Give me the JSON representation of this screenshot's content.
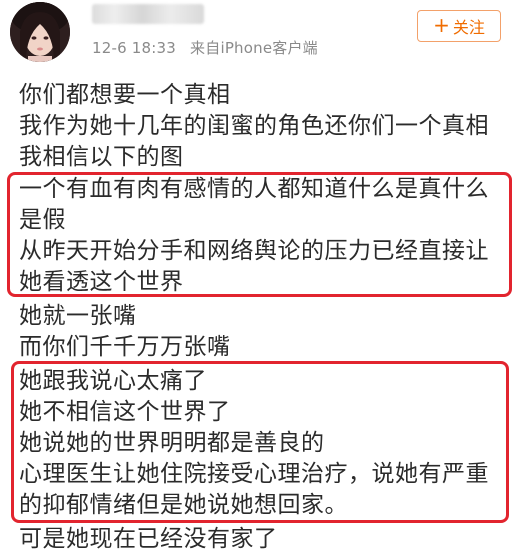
{
  "header": {
    "time": "12-6 18:33",
    "source": "来自iPhone客户端",
    "follow_label": "关注",
    "follow_icon": "plus-icon"
  },
  "post": {
    "lines": [
      "你们都想要一个真相",
      "我作为她十几年的闺蜜的角色还你们一个真相",
      "我相信以下的图",
      "一个有血有肉有感情的人都知道什么是真什么",
      "是假",
      "从昨天开始分手和网络舆论的压力已经直接让",
      "她看透这个世界",
      "她就一张嘴",
      "而你们千千万万张嘴",
      "她跟我说心太痛了",
      "她不相信这个世界了",
      "她说她的世界明明都是善良的",
      "心理医生让她住院接受心理治疗，说她有严重",
      "的抑郁情绪但是她说她想回家。",
      "可是她现在已经没有家了"
    ]
  },
  "colors": {
    "highlight": "#e2242e",
    "follow": "#f06c00",
    "meta": "#8a8a8a"
  }
}
